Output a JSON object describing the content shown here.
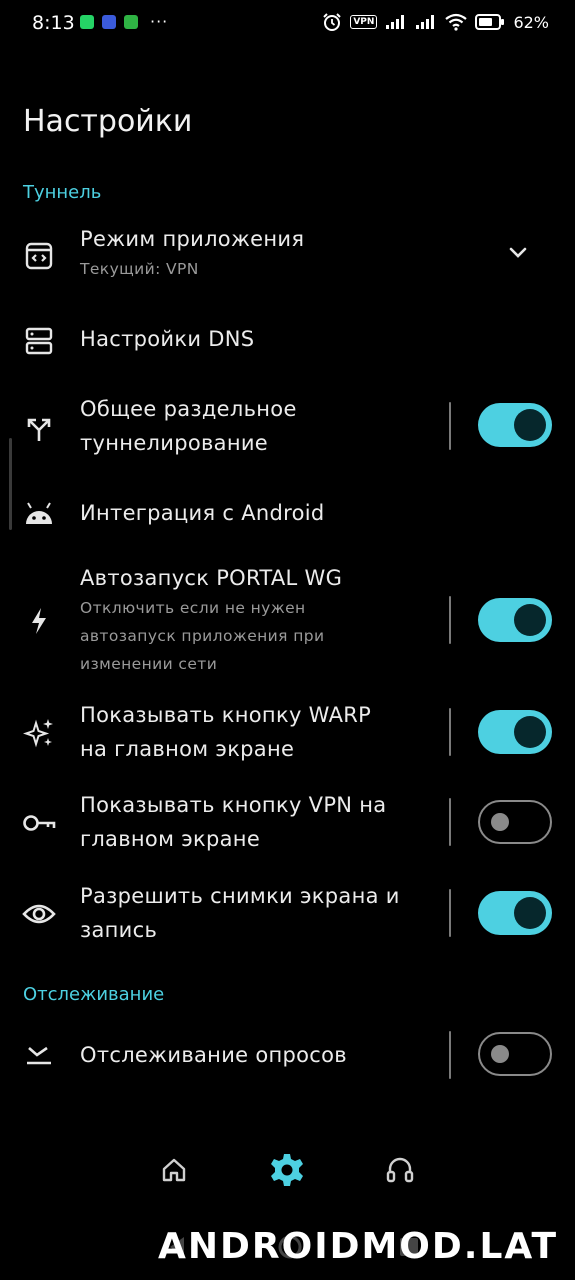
{
  "status_bar": {
    "time": "8:13",
    "dots": "···",
    "vpn_badge": "VPN",
    "battery": "62%"
  },
  "page": {
    "title": "Настройки"
  },
  "sections": {
    "tunnel": "Туннель",
    "tracking": "Отслеживание"
  },
  "settings": {
    "app_mode": {
      "title": "Режим приложения",
      "subtitle": "Текущий: VPN",
      "icon": "app-mode-icon"
    },
    "dns": {
      "title": "Настройки DNS",
      "icon": "dns-server-icon"
    },
    "split_tunnel": {
      "title_line1": "Общее раздельное",
      "title_line2": "туннелирование",
      "enabled": true,
      "icon": "split-arrows-icon"
    },
    "android": {
      "title": "Интеграция с Android",
      "icon": "android-icon"
    },
    "autostart": {
      "title": "Автозапуск PORTAL WG",
      "sub_line1": "Отключить если не нужен",
      "sub_line2": "автозапуск приложения при",
      "sub_line3": "изменении сети",
      "enabled": true,
      "icon": "bolt-icon"
    },
    "warp_button": {
      "title_line1": "Показывать кнопку WARP",
      "title_line2": "на главном экране",
      "enabled": true,
      "icon": "sparkle-icon"
    },
    "vpn_button": {
      "title_line1": "Показывать кнопку VPN на",
      "title_line2": "главном экране",
      "enabled": false,
      "icon": "key-icon"
    },
    "screenshots": {
      "title_line1": "Разрешить снимки экрана и",
      "title_line2": "запись",
      "enabled": true,
      "icon": "eye-icon"
    },
    "poll_tracking": {
      "title": "Отслеживание опросов",
      "enabled": false,
      "icon": "poll-tracking-icon"
    }
  },
  "bottom_nav": {
    "items": [
      "home-icon",
      "settings-gear-icon",
      "headset-icon"
    ],
    "active": "settings-gear-icon"
  },
  "watermark": "ANDROIDMOD.LAT",
  "colors": {
    "accent": "#4dd0e1",
    "background": "#000000",
    "knob_on": "#06272c",
    "toggle_off": "#8a8a8a"
  }
}
